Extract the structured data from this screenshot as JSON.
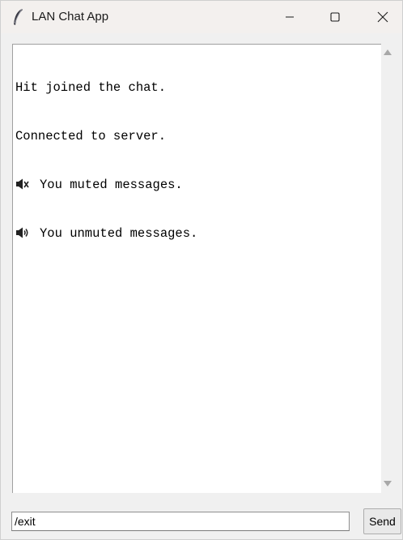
{
  "window": {
    "title": "LAN Chat App",
    "app_icon": "feather-icon"
  },
  "titlebar_buttons": {
    "minimize": "minimize-icon",
    "maximize": "maximize-icon",
    "close": "close-icon"
  },
  "chat": {
    "lines": [
      {
        "icon": null,
        "text": "Hit joined the chat."
      },
      {
        "icon": null,
        "text": "Connected to server."
      },
      {
        "icon": "speaker-muted-icon",
        "text": "You muted messages."
      },
      {
        "icon": "speaker-on-icon",
        "text": "You unmuted messages."
      }
    ]
  },
  "input": {
    "value": "/exit"
  },
  "send_button": {
    "label": "Send"
  }
}
